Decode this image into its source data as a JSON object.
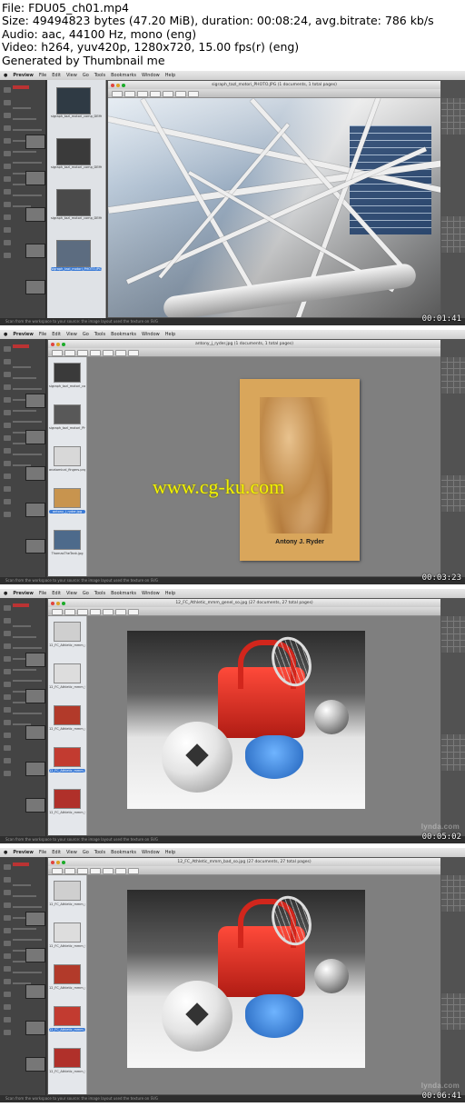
{
  "header": {
    "file": "File: FDU05_ch01.mp4",
    "size": "Size: 49494823 bytes (47.20 MiB), duration: 00:08:24, avg.bitrate: 786 kb/s",
    "audio": "Audio: aac, 44100 Hz, mono (eng)",
    "video": "Video: h264, yuv420p, 1280x720, 15.00 fps(r) (eng)",
    "generated": "Generated by Thumbnail me"
  },
  "menubar": {
    "app": "Preview",
    "items": [
      "File",
      "Edit",
      "View",
      "Go",
      "Tools",
      "Bookmarks",
      "Window",
      "Help"
    ]
  },
  "frames": [
    {
      "timestamp": "00:01:41",
      "window_title": "sigraph_tazl_motori_PHOTO.JPG (1 documents, 1 total pages)",
      "kind": "photo",
      "thumbs": [
        "sigraph_tazl_motori_comp_DEMO_1.jpg",
        "sigraph_tazl_motori_comp_DEMO_2.jpg",
        "sigraph_tazl_motori_comp_DEMO_3.jpg",
        "sigraph_tazl_motori_PHOTO.JPG"
      ],
      "status": "Scan from the workspace to your source: the image layout used the texture on SVG"
    },
    {
      "timestamp": "00:03:23",
      "window_title": "antony_j_ryder.jpg (1 documents, 1 total pages)",
      "kind": "art",
      "thumbs": [
        "sigraph_tazl_motori_comp_DEMO_3",
        "sigraph_tazl_motori_PHOTO.JPG",
        "anatomical_fingers.png",
        "antony_j_ryder.jpg",
        "ThomasTheTank.jpg"
      ],
      "caption": "Antony J. Ryder",
      "watermark": "www.cg-ku.com",
      "status": "Scan from the workspace to your source: the image layout used the texture on SVG"
    },
    {
      "timestamp": "00:05:02",
      "window_title": "12_FC_Athletic_mmm_genel_so.jpg (27 documents, 27 total pages)",
      "kind": "render",
      "thumbs": [
        "12_FC_Athletic_mmm_genel.Roberts",
        "12_FC_Athletic_mmm_tiacpack.indirect",
        "12_FC_Athletic_mmm_nbs_so.jpg",
        "12_FC_Athletic_mmm_genel_so.jpg",
        "12_FC_Athletic_mmm_tiacpack.nbs"
      ],
      "status": "Scan from the workspace to your source: the image layout used the texture on SVG"
    },
    {
      "timestamp": "00:06:41",
      "window_title": "12_FC_Athletic_mmm_bad_so.jpg (27 documents, 27 total pages)",
      "kind": "render",
      "thumbs": [
        "12_FC_Athletic_mmm_genel.Roberts",
        "12_FC_Athletic_mmm_tiacpack.indirect",
        "12_FC_Athletic_mmm_nbs_so.jpg",
        "12_FC_Athletic_mmm_genel_so.jpg",
        "12_FC_Athletic_mmm_tiacpack.nbs"
      ],
      "status": "Scan from the workspace to your source: the image layout used the texture on SVG"
    }
  ],
  "left_panel_thumbs": [
    "sigraph_tazl_motori_comp_DEMO_2",
    "sigraph_tazl_motori_PHOTO.JPG",
    "anatomical_fingers_Noguer.png",
    "antony_j_ryder.jp",
    "ThomasTheTankS.jpg"
  ]
}
